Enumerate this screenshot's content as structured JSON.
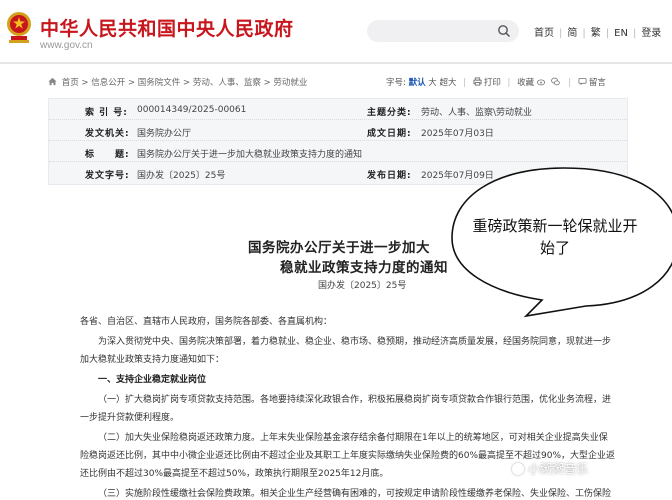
{
  "header": {
    "site_title": "中华人民共和国中央人民政府",
    "site_url": "www.gov.cn",
    "links": [
      "首页",
      "简",
      "繁",
      "EN",
      "登录"
    ]
  },
  "breadcrumb": {
    "items": [
      "首页",
      "信息公开",
      "国务院文件",
      "劳动、人事、监察",
      "劳动就业"
    ],
    "separator": ">"
  },
  "tools": {
    "font_label": "字号:",
    "font_sizes": [
      "默认",
      "大",
      "超大"
    ],
    "print": "打印",
    "favorite": "收藏",
    "message": "留言"
  },
  "info": {
    "index_no_label": "索 引 号:",
    "index_no": "000014349/2025-00061",
    "topic_label": "主题分类:",
    "topic": "劳动、人事、监察\\劳动就业",
    "issuer_label": "发文机关:",
    "issuer": "国务院办公厅",
    "created_label": "成文日期:",
    "created": "2025年07月03日",
    "title_label": "标　　题:",
    "title": "国务院办公厅关于进一步加大稳就业政策支持力度的通知",
    "docno_label": "发文字号:",
    "docno": "国办发〔2025〕25号",
    "published_label": "发布日期:",
    "published": "2025年07月09日"
  },
  "article": {
    "title_line1": "国务院办公厅关于进一步加大",
    "title_line2": "稳就业政策支持力度的通知",
    "doc_no": "国办发〔2025〕25号",
    "paragraphs": [
      "各省、自治区、直辖市人民政府，国务院各部委、各直属机构：",
      "为深入贯彻党中央、国务院决策部署，着力稳就业、稳企业、稳市场、稳预期，推动经济高质量发展，经国务院同意，现就进一步",
      "加大稳就业政策支持力度通知如下：",
      "一、支持企业稳定就业岗位",
      "（一）扩大稳岗扩岗专项贷款支持范围。各地要持续深化政银合作，积极拓展稳岗扩岗专项贷款合作银行范围，优化业务流程，进",
      "一步提升贷款便利程度。",
      "（二）加大失业保险稳岗返还政策力度。上年末失业保险基金滚存结余备付期限在1年以上的统筹地区，可对相关企业提高失业保",
      "险稳岗返还比例，其中中小微企业返还比例由不超过企业及其职工上年度实际缴纳失业保险费的60%最高提至不超过90%，大型企业返",
      "还比例由不超过30%最高提至不超过50%，政策执行期限至2025年12月底。",
      "（三）实施阶段性缓缴社会保险费政策。相关企业生产经营确有困难的，可按规定申请阶段性缓缴养老保险、失业保险、工伤保险"
    ]
  },
  "overlay": {
    "bubble_text": "重磅政策新一轮保就业开始了",
    "watermark": "小粥粥音乐"
  },
  "colors": {
    "brand_red": "#c8161d",
    "link_blue": "#1a57b0",
    "info_bg": "#f4f6f8"
  }
}
